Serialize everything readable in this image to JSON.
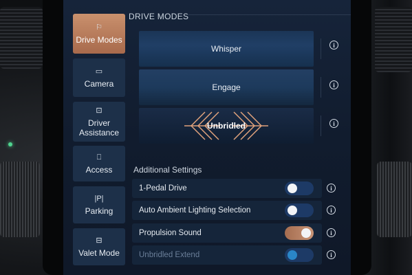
{
  "section_title": "DRIVE MODES",
  "sidebar": {
    "items": [
      {
        "label": "Drive Modes",
        "icon": "⚐"
      },
      {
        "label": "Camera",
        "icon": "▭"
      },
      {
        "label": "Driver Assistance",
        "icon": "⊡"
      },
      {
        "label": "Access",
        "icon": "⎕"
      },
      {
        "label": "Parking",
        "icon": "|P|"
      },
      {
        "label": "Valet Mode",
        "icon": "⊟"
      }
    ],
    "active_index": 0
  },
  "modes": [
    {
      "label": "Whisper"
    },
    {
      "label": "Engage"
    },
    {
      "label": "Unbridled"
    }
  ],
  "info_glyph": "i",
  "additional_settings_title": "Additional Settings",
  "settings": [
    {
      "label": "1-Pedal Drive",
      "state": "off"
    },
    {
      "label": "Auto Ambient Lighting Selection",
      "state": "off"
    },
    {
      "label": "Propulsion Sound",
      "state": "on"
    },
    {
      "label": "Unbridled Extend",
      "state": "disabled"
    }
  ],
  "colors": {
    "accent_copper": "#c9906d",
    "toggle_off": "#1d3a66",
    "disabled_knob": "#2a86c8"
  }
}
